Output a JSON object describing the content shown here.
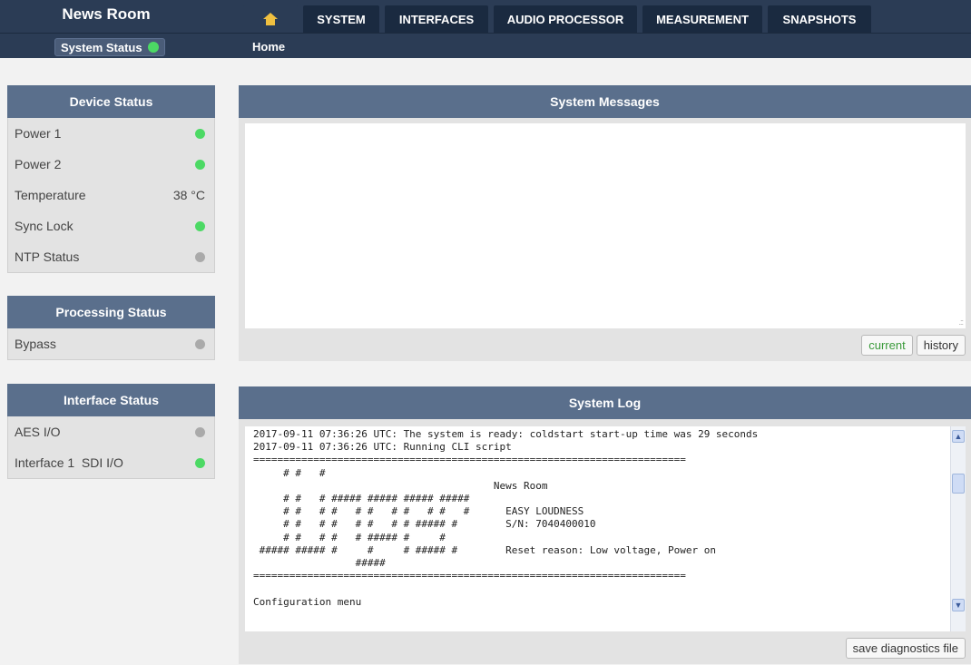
{
  "header": {
    "brand": "News Room",
    "system_status_label": "System Status",
    "breadcrumb": "Home",
    "tabs": [
      "SYSTEM",
      "INTERFACES",
      "AUDIO PROCESSOR",
      "MEASUREMENT",
      "SNAPSHOTS"
    ]
  },
  "device_status": {
    "title": "Device Status",
    "items": [
      {
        "label": "Power 1",
        "value": ""
      },
      {
        "label": "Power 2",
        "value": ""
      },
      {
        "label": "Temperature",
        "value": "38 °C"
      },
      {
        "label": "Sync Lock",
        "value": ""
      },
      {
        "label": "NTP Status",
        "value": ""
      }
    ]
  },
  "processing_status": {
    "title": "Processing Status",
    "items": [
      {
        "label": "Bypass"
      }
    ]
  },
  "interface_status": {
    "title": "Interface Status",
    "items": [
      {
        "label": "AES I/O"
      },
      {
        "label": "Interface 1  SDI I/O"
      }
    ]
  },
  "system_messages": {
    "title": "System Messages",
    "current_label": "current",
    "history_label": "history"
  },
  "system_log": {
    "title": "System Log",
    "text": "2017-09-11 07:36:26 UTC: The system is ready: coldstart start-up time was 29 seconds\n2017-09-11 07:36:26 UTC: Running CLI script\n========================================================================\n     # #   #\n                                        News Room\n     # #   # ##### ##### ##### #####\n     # #   # #   # #   # #   # #   #      EASY LOUDNESS\n     # #   # #   # #   # # ##### #        S/N: 7040400010\n     # #   # #   # ##### #     #\n ##### ##### #     #     # ##### #        Reset reason: Low voltage, Power on\n                 #####\n========================================================================\n\nConfiguration menu",
    "save_label": "save diagnostics file"
  },
  "colors": {
    "led_green": "#4cd964",
    "led_gray": "#aaaaaa",
    "navy": "#2b3c55",
    "panel_header": "#5a6f8c"
  }
}
